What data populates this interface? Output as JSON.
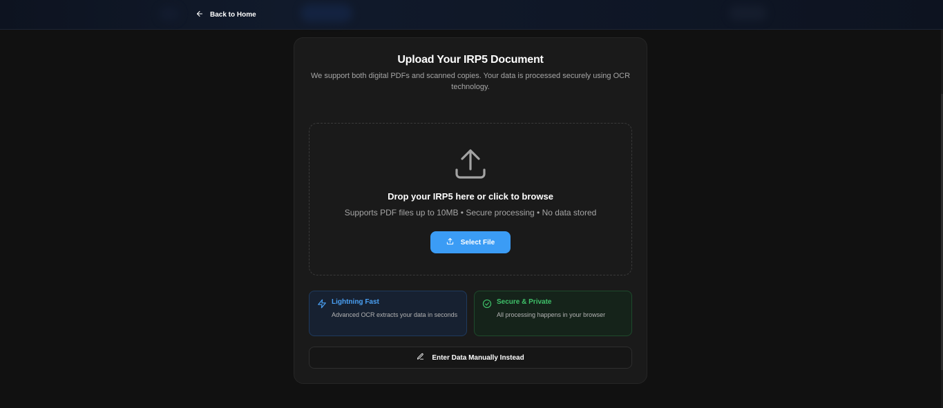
{
  "header": {
    "back_label": "Back to Home",
    "back_icon": "arrow-left-icon"
  },
  "upload_card": {
    "title": "Upload Your IRP5 Document",
    "subtitle": "We support both digital PDFs and scanned copies. Your data is processed securely using OCR technology.",
    "dropzone": {
      "icon": "upload-icon",
      "title": "Drop your IRP5 here or click to browse",
      "subtitle": "Supports PDF files up to 10MB • Secure processing • No data stored",
      "button_label": "Select File"
    },
    "features": [
      {
        "icon": "lightning-icon",
        "title": "Lightning Fast",
        "description": "Advanced OCR extracts your data in seconds",
        "color": "#4aa1f5"
      },
      {
        "icon": "check-circle-icon",
        "title": "Secure & Private",
        "description": "All processing happens in your browser",
        "color": "#3fc26a"
      }
    ],
    "manual_label": "Enter Data Manually Instead",
    "manual_icon": "pencil-icon"
  },
  "colors": {
    "accent": "#3b9cf5",
    "background": "#111111",
    "card": "#1a1a1a"
  }
}
